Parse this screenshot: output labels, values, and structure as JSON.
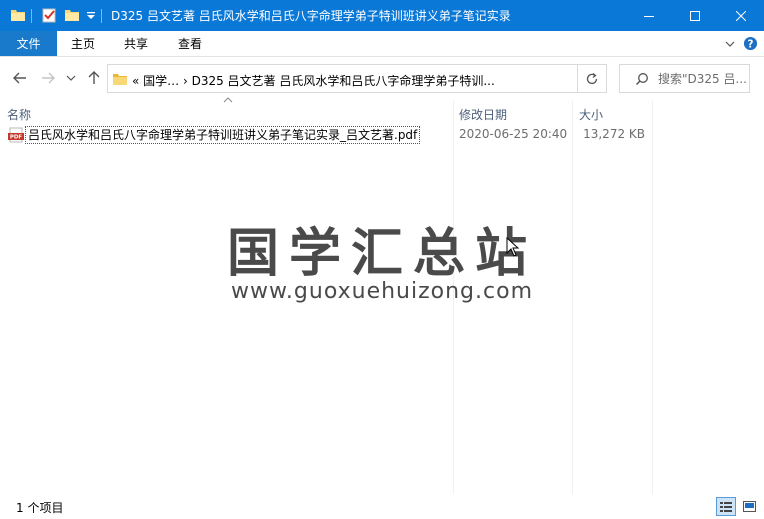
{
  "window": {
    "title": "D325 吕文艺著 吕氏风水学和吕氏八字命理学弟子特训班讲义弟子笔记实录"
  },
  "ribbon": {
    "file": "文件",
    "home": "主页",
    "share": "共享",
    "view": "查看"
  },
  "address": {
    "path": "«  国学…  ›  D325 吕文艺著 吕氏风水学和吕氏八字命理学弟子特训..."
  },
  "search": {
    "placeholder": "搜索\"D325 吕..."
  },
  "columns": {
    "name": "名称",
    "date": "修改日期",
    "size": "大小"
  },
  "files": [
    {
      "name": "吕氏风水学和吕氏八字命理学弟子特训班讲义弟子笔记实录_吕文艺著.pdf",
      "date": "2020-06-25 20:40",
      "size": "13,272 KB",
      "icon": "pdf-file-icon"
    }
  ],
  "watermark": {
    "chinese": "国学汇总站",
    "url": "www.guoxuehuizong.com"
  },
  "status": {
    "count": "1 个项目"
  },
  "colors": {
    "titlebar": "#0a78d7",
    "file_tab": "#1979ca",
    "header_text": "#4c607a"
  }
}
